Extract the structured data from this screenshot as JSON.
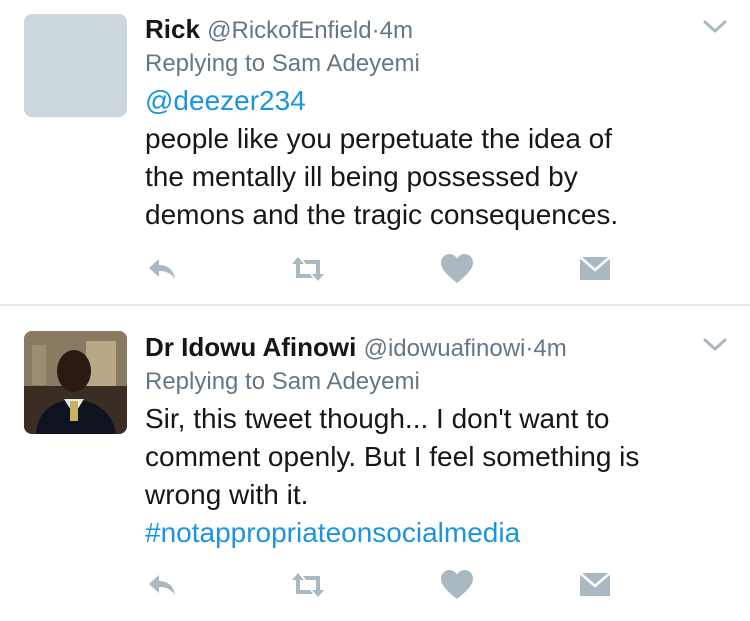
{
  "tweets": [
    {
      "name": "Rick",
      "handle": "@RickofEnfield",
      "separator": "·",
      "time": "4m",
      "replying_to": "Replying to Sam Adeyemi",
      "mention": "@deezer234",
      "body_lines": [
        "people like you perpetuate the idea of",
        "the mentally ill being possessed by",
        "demons and the tragic consequences."
      ],
      "avatar": "placeholder-avatar"
    },
    {
      "name": "Dr Idowu Afinowi",
      "handle": "@idowuafinowi",
      "separator": "·",
      "time": "4m",
      "replying_to": "Replying to Sam Adeyemi",
      "body_lines": [
        "Sir, this tweet though... I don't want to",
        "comment openly. But I feel something is",
        "wrong with it."
      ],
      "hashtag": "#notappropriateonsocialmedia",
      "avatar": "user-photo-avatar"
    }
  ],
  "icons": {
    "reply": "reply-icon",
    "retweet": "retweet-icon",
    "like": "heart-icon",
    "dm": "direct-message-icon",
    "menu": "chevron-down-icon"
  },
  "colors": {
    "link": "#1b95e0",
    "muted": "#657786",
    "icon": "#aab8c2",
    "divider": "#e1e8ed"
  }
}
